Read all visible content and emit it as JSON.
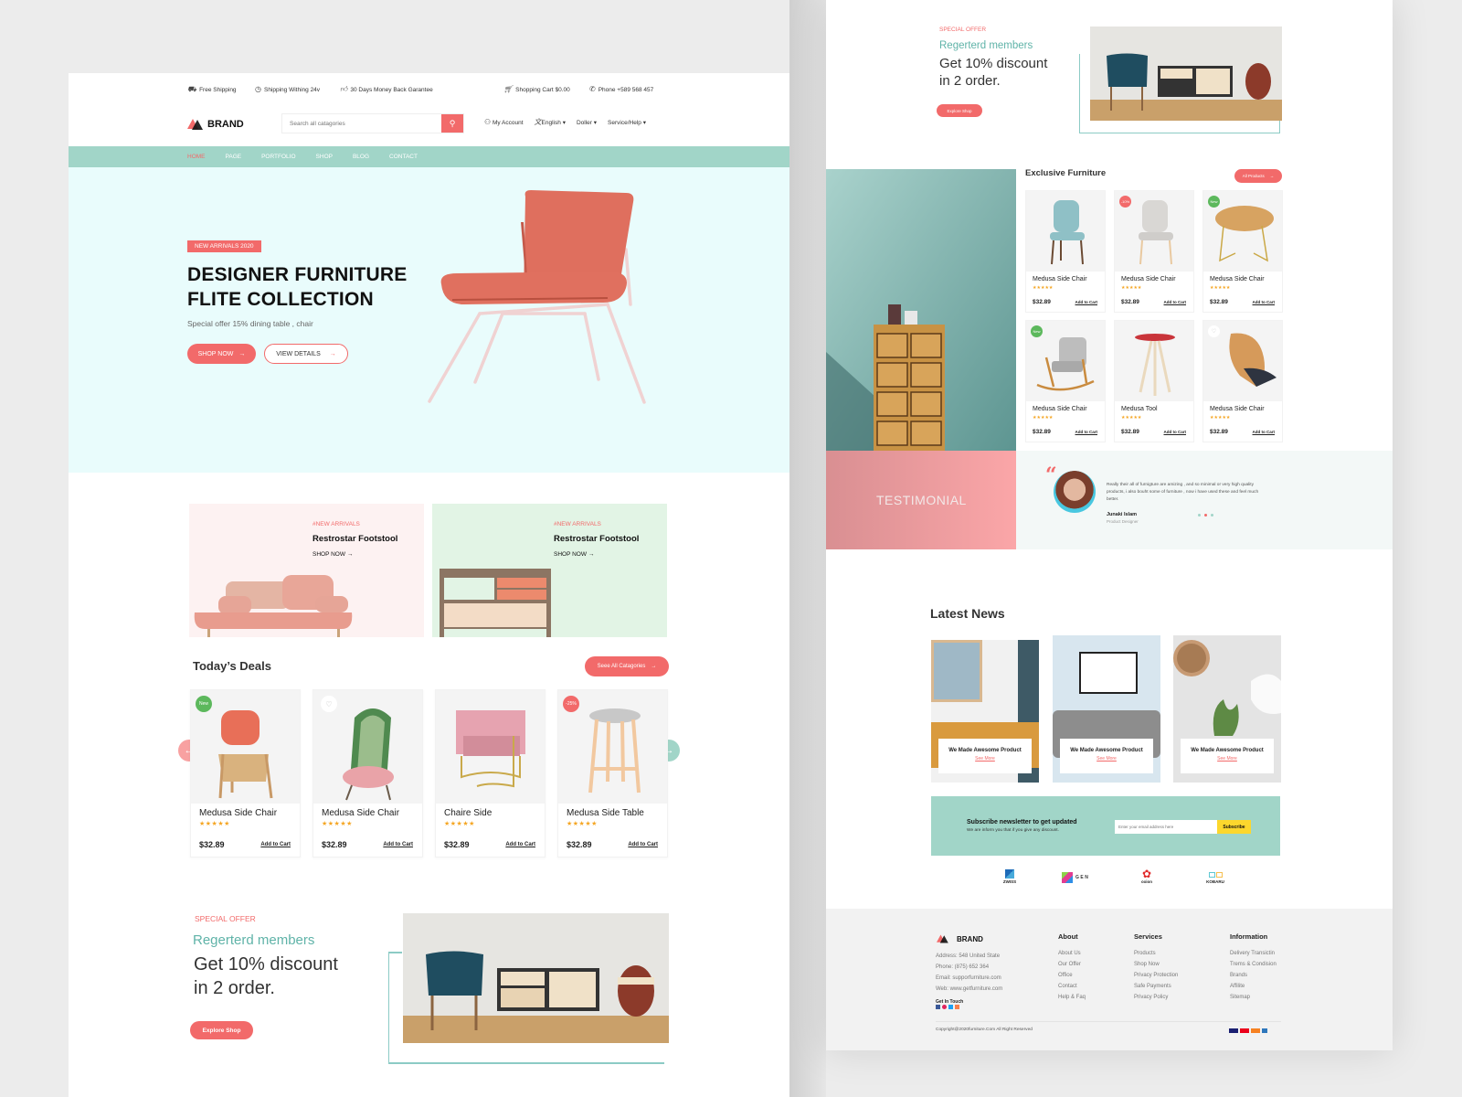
{
  "topbar": {
    "free_shipping": "Free Shipping",
    "shipping_24": "Shipping Withing 24v",
    "money_back": "30 Days Money Back Garantee",
    "cart": "Shopping Cart $0.00",
    "phone": "Phone +589 568 457"
  },
  "header": {
    "brand": "BRAND",
    "search_placeholder": "Search all catagories",
    "my_account": "My Account",
    "language": "English",
    "currency": "Doller",
    "service": "Service/Help"
  },
  "nav": {
    "items": [
      "HOME",
      "PAGE",
      "PORTFOLIO",
      "SHOP",
      "BLOG",
      "CONTACT"
    ]
  },
  "hero": {
    "tag": "NEW ARRIVALS 2020",
    "title_line1": "DESIGNER FURNITURE",
    "title_line2": "FLITE COLLECTION",
    "subtitle": "Special offer 15% dining table , chair",
    "shop_now": "SHOP NOW",
    "view_details": "VIEW DETAILS"
  },
  "promos": [
    {
      "tag": "#NEW ARRIVALS",
      "title": "Restrostar Footstool",
      "cta": "SHOP NOW"
    },
    {
      "tag": "#NEW ARRIVALS",
      "title": "Restrostar Footstool",
      "cta": "SHOP NOW"
    }
  ],
  "deals": {
    "title": "Today’s Deals",
    "see_all": "Seee All Catagories",
    "products": [
      {
        "name": "Medusa Side Chair",
        "price": "$32.89",
        "add": "Add to Cart",
        "badge": "New",
        "stars": "★★★★★"
      },
      {
        "name": "Medusa Side Chair",
        "price": "$32.89",
        "add": "Add to Cart",
        "badge": "",
        "stars": "★★★★★"
      },
      {
        "name": "Chaire Side",
        "price": "$32.89",
        "add": "Add to Cart",
        "badge": "",
        "stars": "★★★★★"
      },
      {
        "name": "Medusa Side Table",
        "price": "$32.89",
        "add": "Add to Cart",
        "badge": "-25%",
        "stars": "★★★★★"
      }
    ]
  },
  "offer": {
    "label": "SPECIAL OFFER",
    "members": "Regerterd members",
    "discount_line1": "Get 10% discount",
    "discount_line2": "in 2 order.",
    "cta": "Explore Shop"
  },
  "exclusive": {
    "title": "Exclusive Furniture",
    "all_products": "All Products",
    "products": [
      {
        "name": "Medusa Side Chair",
        "price": "$32.89",
        "add": "Add to Cart",
        "badge": "",
        "stars": "★★★★★"
      },
      {
        "name": "Medusa Side Chair",
        "price": "$32.89",
        "add": "Add to Cart",
        "badge": "-10%",
        "stars": "★★★★★"
      },
      {
        "name": "Medusa Side Chair",
        "price": "$32.89",
        "add": "Add to Cart",
        "badge": "New",
        "stars": "★★★★★"
      },
      {
        "name": "Medusa Side Chair",
        "price": "$32.89",
        "add": "Add to Cart",
        "badge": "New",
        "stars": "★★★★★"
      },
      {
        "name": "Medusa Tool",
        "price": "$32.89",
        "add": "Add to Cart",
        "badge": "",
        "stars": "★★★★★"
      },
      {
        "name": "Medusa Side Chair",
        "price": "$32.89",
        "add": "Add to Cart",
        "badge": "",
        "stars": "★★★★★"
      }
    ]
  },
  "testimonial": {
    "title": "TESTIMONIAL",
    "quote": "Really their all of furnigture are amizing , and so minimal or very high quality products, i also bouht some of furniture , now i have used these and feel much better.",
    "name": "Junaki Islam",
    "role": "Product Designer"
  },
  "news": {
    "title": "Latest News",
    "items": [
      {
        "title": "We Made Awesome Product",
        "more": "See More"
      },
      {
        "title": "We Made Awesome Product",
        "more": "See More"
      },
      {
        "title": "We Made Awesome Product",
        "more": "See More"
      }
    ]
  },
  "newsletter": {
    "title": "Subscribe newsletter to get updated",
    "subtitle": "We are inform  you that if you give any discount.",
    "placeholder": "Enter your email address here",
    "button": "Subscribe"
  },
  "brands": [
    "ZWISS",
    "GEN",
    "oxion",
    "KOBARU"
  ],
  "footer": {
    "brand": "BRAND",
    "address": "Address: 548 United State",
    "phone": "Phone: (875) 652 364",
    "email": "Email: supporfurniture.com",
    "web": "Web: www.getfurniture.com",
    "get_in_touch": "Get In Touch",
    "about": {
      "title": "About",
      "links": [
        "About Us",
        "Our Offer",
        "Office",
        "Contact",
        "Help & Faq"
      ]
    },
    "services": {
      "title": "Services",
      "links": [
        "Products",
        "Shop Now",
        "Privacy Protection",
        "Safe Payments",
        "Privacy Policy"
      ]
    },
    "information": {
      "title": "Information",
      "links": [
        "Delivery Transictin",
        "Trems & Condision",
        "Brands",
        "Affilite",
        "Sitemap"
      ]
    },
    "copyright": "Copyright@2020furniture.Com All Right Reserved"
  },
  "colors": {
    "accent": "#f26a6a",
    "mint": "#a1d5c8",
    "hero_bg": "#e9fcfc",
    "star": "#f5a623",
    "teal_text": "#5fb3a8",
    "subscribe": "#fcd72d"
  }
}
